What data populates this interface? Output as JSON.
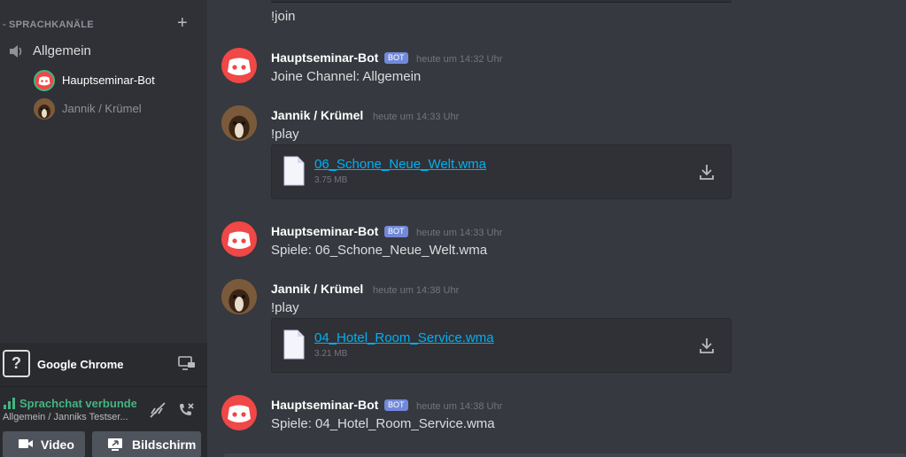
{
  "sidebar": {
    "section_title": "SPRACHKANÄLE",
    "add_label": "+",
    "voice_channel": "Allgemein",
    "voice_users": [
      {
        "name": "Hauptseminar-Bot",
        "active": true
      },
      {
        "name": "Jannik / Krümel",
        "active": false
      }
    ],
    "stream_app": "Google Chrome",
    "status_connected": "Sprachchat verbunden",
    "status_location": "Allgemein / Janniks Testser...",
    "video_label": "Video",
    "screen_label": "Bildschirm"
  },
  "chat": {
    "top_text": "!join",
    "bot_tag": "BOT",
    "messages": [
      {
        "author": "Hauptseminar-Bot",
        "bot": true,
        "timestamp": "heute um 14:32 Uhr",
        "text": "Joine Channel: Allgemein"
      },
      {
        "author": "Jannik / Krümel",
        "bot": false,
        "timestamp": "heute um 14:33 Uhr",
        "text": "!play",
        "file": {
          "name": "06_Schone_Neue_Welt.wma",
          "size": "3.75 MB"
        }
      },
      {
        "author": "Hauptseminar-Bot",
        "bot": true,
        "timestamp": "heute um 14:33 Uhr",
        "text": "Spiele: 06_Schone_Neue_Welt.wma"
      },
      {
        "author": "Jannik / Krümel",
        "bot": false,
        "timestamp": "heute um 14:38 Uhr",
        "text": "!play",
        "file": {
          "name": "04_Hotel_Room_Service.wma",
          "size": "3.21 MB"
        }
      },
      {
        "author": "Hauptseminar-Bot",
        "bot": true,
        "timestamp": "heute um 14:38 Uhr",
        "text": "Spiele: 04_Hotel_Room_Service.wma"
      }
    ]
  },
  "colors": {
    "accent": "#7289da",
    "online": "#43b581",
    "link": "#00b0f4",
    "bot_avatar": "#f04747"
  },
  "icons": [
    "chevron-down-icon",
    "plus-icon",
    "speaker-icon",
    "discord-icon",
    "question-icon",
    "screen-share-icon",
    "signal-icon",
    "voice-settings-icon",
    "disconnect-icon",
    "video-icon",
    "file-icon",
    "download-icon"
  ]
}
